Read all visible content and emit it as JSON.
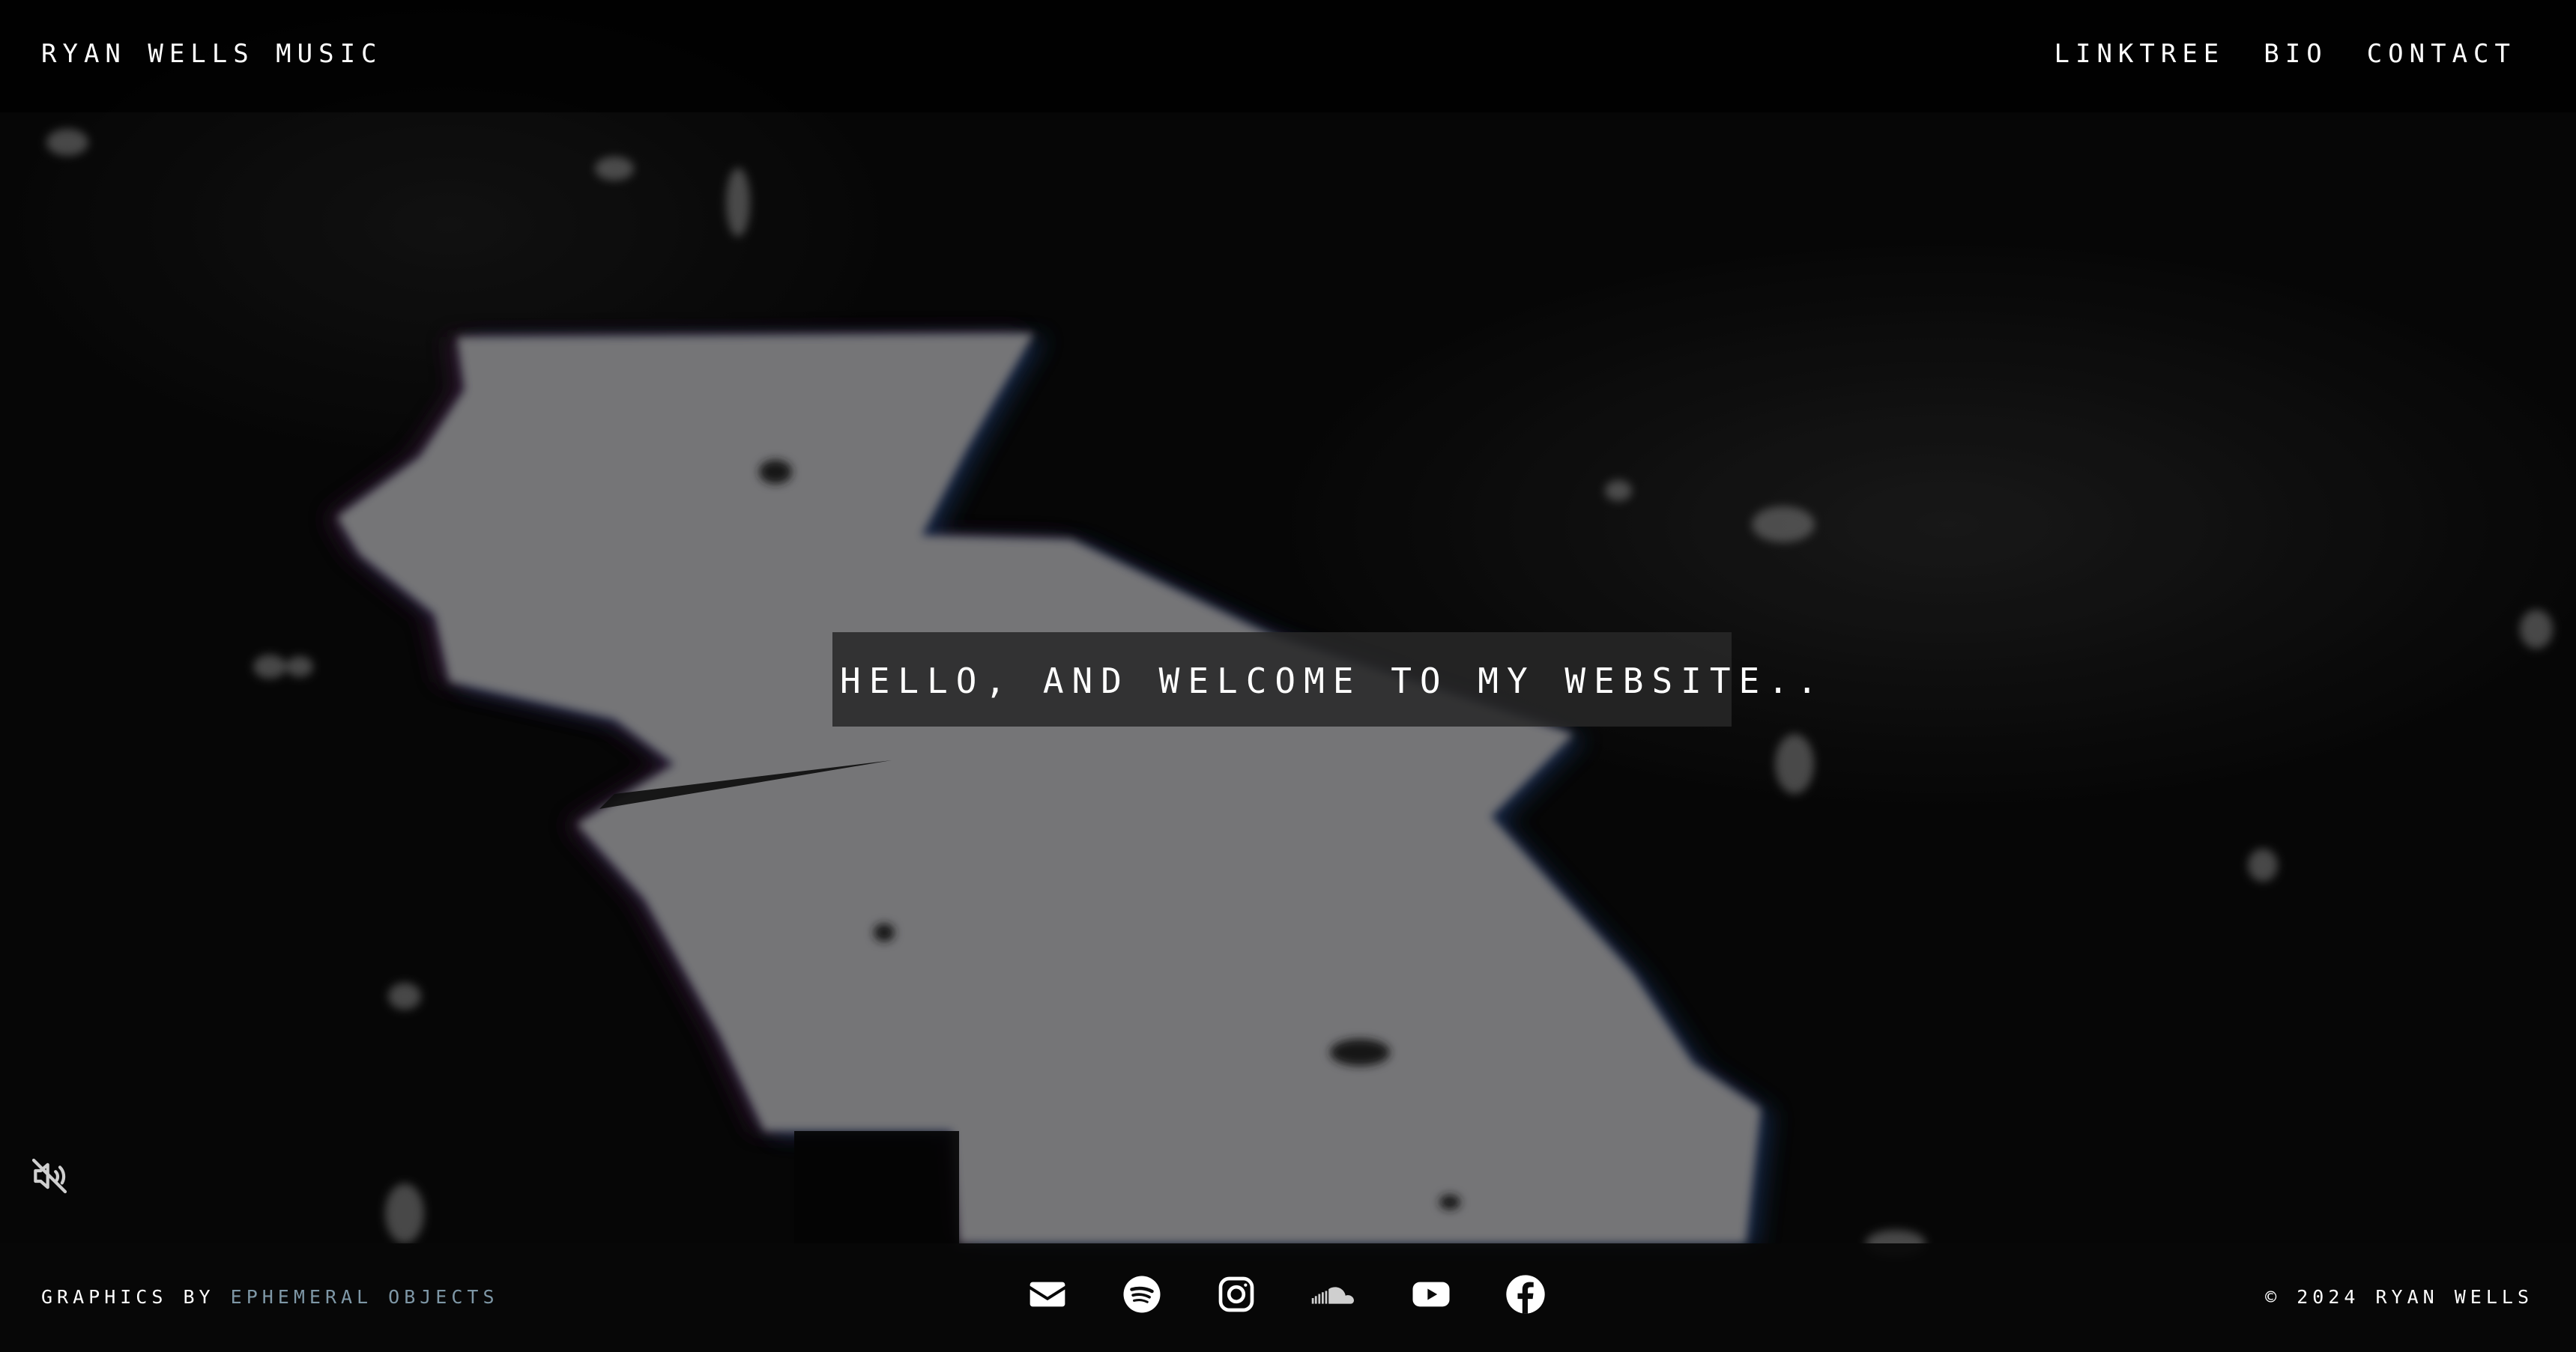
{
  "header": {
    "brand": "RYAN WELLS MUSIC",
    "nav": [
      {
        "label": "LINKTREE"
      },
      {
        "label": "BIO"
      },
      {
        "label": "CONTACT"
      }
    ]
  },
  "hero": {
    "welcome_text": "HELLO, AND WELCOME TO MY WEBSITE..",
    "mute_icon": "volume-muted-icon"
  },
  "footer": {
    "credits_prefix": "GRAPHICS BY",
    "credits_link": "EPHEMERAL OBJECTS",
    "copyright": "© 2024 RYAN WELLS",
    "socials": [
      {
        "icon": "envelope-icon"
      },
      {
        "icon": "spotify-icon"
      },
      {
        "icon": "instagram-icon"
      },
      {
        "icon": "soundcloud-icon"
      },
      {
        "icon": "youtube-icon"
      },
      {
        "icon": "facebook-icon"
      }
    ]
  },
  "colors": {
    "background": "#060606",
    "text": "#ffffff",
    "credits_link": "#7e97a6",
    "banner": "#282828"
  }
}
